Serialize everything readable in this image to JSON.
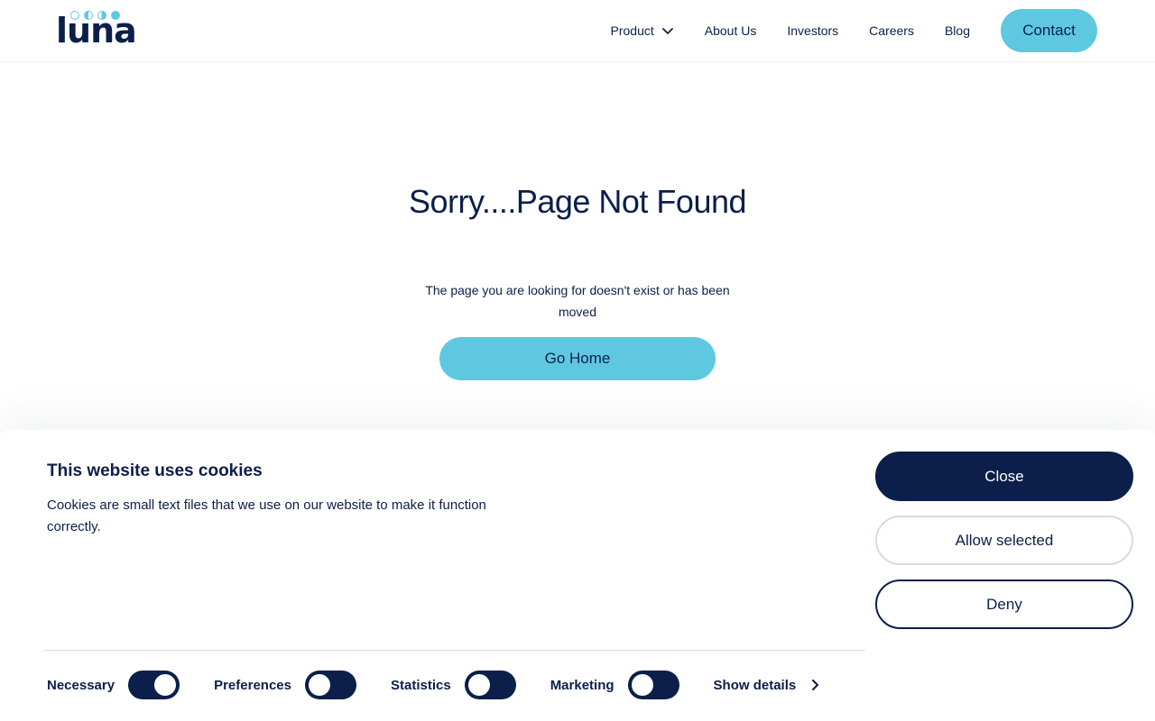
{
  "header": {
    "logo_text": "luna",
    "nav": {
      "product": "Product",
      "about": "About Us",
      "investors": "Investors",
      "careers": "Careers",
      "blog": "Blog"
    },
    "contact_label": "Contact"
  },
  "main": {
    "title": "Sorry....Page Not Found",
    "subtitle": "The page you are looking for doesn't exist or has been moved",
    "home_button": "Go Home"
  },
  "cookie": {
    "title": "This website uses cookies",
    "text": "Cookies are small text files that we use on our website to make it function correctly.",
    "buttons": {
      "close": "Close",
      "allow_selected": "Allow selected",
      "deny": "Deny"
    },
    "toggles": [
      {
        "label": "Necessary",
        "state": "on"
      },
      {
        "label": "Preferences",
        "state": "off"
      },
      {
        "label": "Statistics",
        "state": "off"
      },
      {
        "label": "Marketing",
        "state": "off"
      }
    ],
    "show_details": "Show details"
  },
  "colors": {
    "navy": "#0b1f4a",
    "accent": "#5fc8e1"
  }
}
